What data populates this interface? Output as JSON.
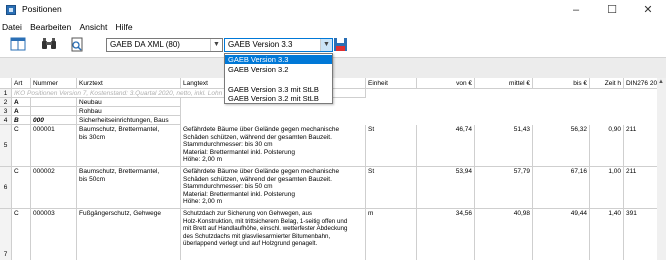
{
  "window": {
    "title": "Positionen",
    "minimize": "–",
    "maximize": "☐",
    "close": "✕"
  },
  "menu": [
    "Datei",
    "Bearbeiten",
    "Ansicht",
    "Hilfe"
  ],
  "toolbar": {
    "format_value": "GAEB DA XML (80)",
    "version_value": "GAEB Version 3.3"
  },
  "dropdown": {
    "options": [
      "GAEB Version 3.3",
      "GAEB Version 3.2",
      "",
      "GAEB Version 3.3 mit StLB",
      "GAEB Version 3.2 mit StLB"
    ],
    "selected_index": 0
  },
  "table": {
    "columns": [
      "",
      "Art",
      "Nummer",
      "Kurztext",
      "Langtext",
      "Einheit",
      "von €",
      "mittel €",
      "bis €",
      "Zeit h",
      "DIN276 2008",
      "DIN276 2"
    ],
    "rows": [
      {
        "n": "1",
        "note": "IKO Positionen Version 7, Kostenstand: 3.Quartal 2020, netto, inkl. Lohn"
      },
      {
        "n": "2",
        "art": "A",
        "nummer": "",
        "kurztext": "Neubau"
      },
      {
        "n": "3",
        "art": "A",
        "nummer": "",
        "kurztext": "Rohbau"
      },
      {
        "n": "4",
        "art": "B",
        "nummer": "000",
        "kurztext": "Sicherheitseinrichtungen, Baus"
      },
      {
        "n": "5",
        "art": "C",
        "nummer": "000001",
        "kurztext": "Baumschutz, Brettermantel,\nbis 30cm",
        "langtext": "Gefährdete Bäume über Gelände gegen mechanische\nSchäden schützen, während der gesamten Bauzeit.\nStammdurchmesser: bis 30 cm\nMaterial: Brettermantel inkl. Polsterung\nHöhe: 2,00 m",
        "einheit": "St",
        "von": "46,74",
        "mittel": "51,43",
        "bis": "56,32",
        "zeit": "0,90",
        "din2008": "211",
        "din2": "211"
      },
      {
        "n": "6",
        "art": "C",
        "nummer": "000002",
        "kurztext": "Baumschutz, Brettermantel,\nbis 50cm",
        "langtext": "Gefährdete Bäume über Gelände gegen mechanische\nSchäden schützen, während der gesamten Bauzeit.\nStammdurchmesser: bis 50 cm\nMaterial: Brettermantel inkl. Polsterung\nHöhe: 2,00 m",
        "einheit": "St",
        "von": "53,94",
        "mittel": "57,79",
        "bis": "67,16",
        "zeit": "1,00",
        "din2008": "211",
        "din2": "211"
      },
      {
        "n": "7",
        "art": "C",
        "nummer": "000003",
        "kurztext": "Fußgängerschutz, Gehwege",
        "langtext": "Schutzdach zur Sicherung von Gehwegen, aus\nHolz-Konstruktion, mit trittsicherem Belag, 1-seitig offen und\nmit Brett auf Handlaufhöhe, einschl. wetterfester Abdeckung\ndes Schutzdachs mit glasvliesarmierter Bitumenbahn,\nüberlappend verlegt und auf Holzgrund genagelt.",
        "einheit": "m",
        "von": "34,56",
        "mittel": "40,98",
        "bis": "49,44",
        "zeit": "1,40",
        "din2008": "391",
        "din2": "391"
      }
    ]
  }
}
